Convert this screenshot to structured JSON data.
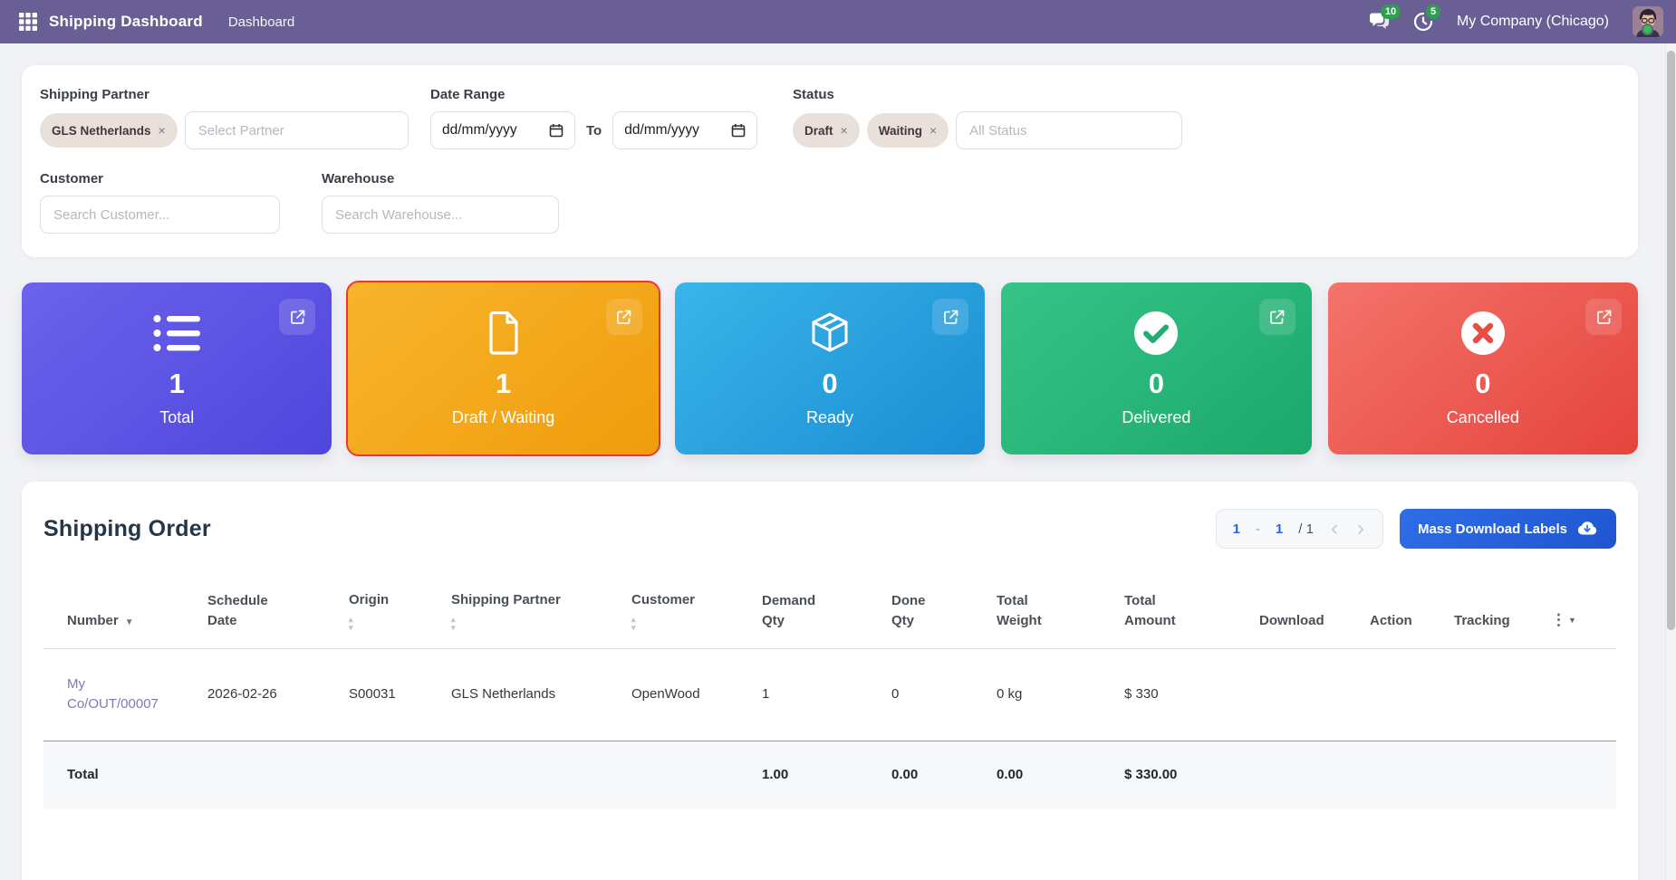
{
  "navbar": {
    "brand": "Shipping Dashboard",
    "menu_item": "Dashboard",
    "messages_badge": "10",
    "activities_badge": "5",
    "company": "My Company (Chicago)",
    "bg_color": "#6a5f94",
    "badge_color": "#2e9e4f"
  },
  "icons": {
    "remove": "×",
    "sort_caret_down": "▼",
    "sort_up": "▴",
    "sort_down": "▾",
    "kebab": "⋮",
    "kebab_caret": "▼",
    "chevron_left": "‹",
    "chevron_right": "›"
  },
  "filters": {
    "shipping_partner": {
      "label": "Shipping Partner",
      "selected_tag": "GLS Netherlands",
      "placeholder": "Select Partner"
    },
    "date_range": {
      "label": "Date Range",
      "from_value": "dd/mm/yyyy",
      "to_label": "To",
      "to_value": "dd/mm/yyyy"
    },
    "status": {
      "label": "Status",
      "selected_tags": [
        "Draft",
        "Waiting"
      ],
      "placeholder": "All Status"
    },
    "customer": {
      "label": "Customer",
      "placeholder": "Search Customer..."
    },
    "warehouse": {
      "label": "Warehouse",
      "placeholder": "Search Warehouse..."
    }
  },
  "stat_cards": [
    {
      "label": "Total",
      "count": "1",
      "icon": "list-icon",
      "color": "#5a50e0"
    },
    {
      "label": "Draft / Waiting",
      "count": "1",
      "icon": "document-icon",
      "color": "#f5a81d",
      "highlighted": true,
      "highlight_border": "#f0352b"
    },
    {
      "label": "Ready",
      "count": "0",
      "icon": "cube-icon",
      "color": "#29a2e2"
    },
    {
      "label": "Delivered",
      "count": "0",
      "icon": "check-circle-icon",
      "color": "#2bbd7e"
    },
    {
      "label": "Cancelled",
      "count": "0",
      "icon": "x-circle-icon",
      "color": "#ee5a52"
    }
  ],
  "orders": {
    "title": "Shipping Order",
    "pagination": {
      "start": "1",
      "separator": "-",
      "end": "1",
      "of": "/ 1"
    },
    "download_button": "Mass Download Labels",
    "columns": [
      "Number",
      "Schedule Date",
      "Origin",
      "Shipping Partner",
      "Customer",
      "Demand Qty",
      "Done Qty",
      "Total Weight",
      "Total Amount",
      "Download",
      "Action",
      "Tracking"
    ],
    "rows": [
      {
        "number": "My Co/OUT/00007",
        "schedule_date": "2026-02-26",
        "origin": "S00031",
        "shipping_partner": "GLS Netherlands",
        "customer": "OpenWood",
        "demand_qty": "1",
        "done_qty": "0",
        "total_weight": "0 kg",
        "total_amount": "$ 330"
      }
    ],
    "footer": {
      "label": "Total",
      "demand_qty": "1.00",
      "done_qty": "0.00",
      "total_weight": "0.00",
      "total_amount": "$ 330.00"
    }
  }
}
